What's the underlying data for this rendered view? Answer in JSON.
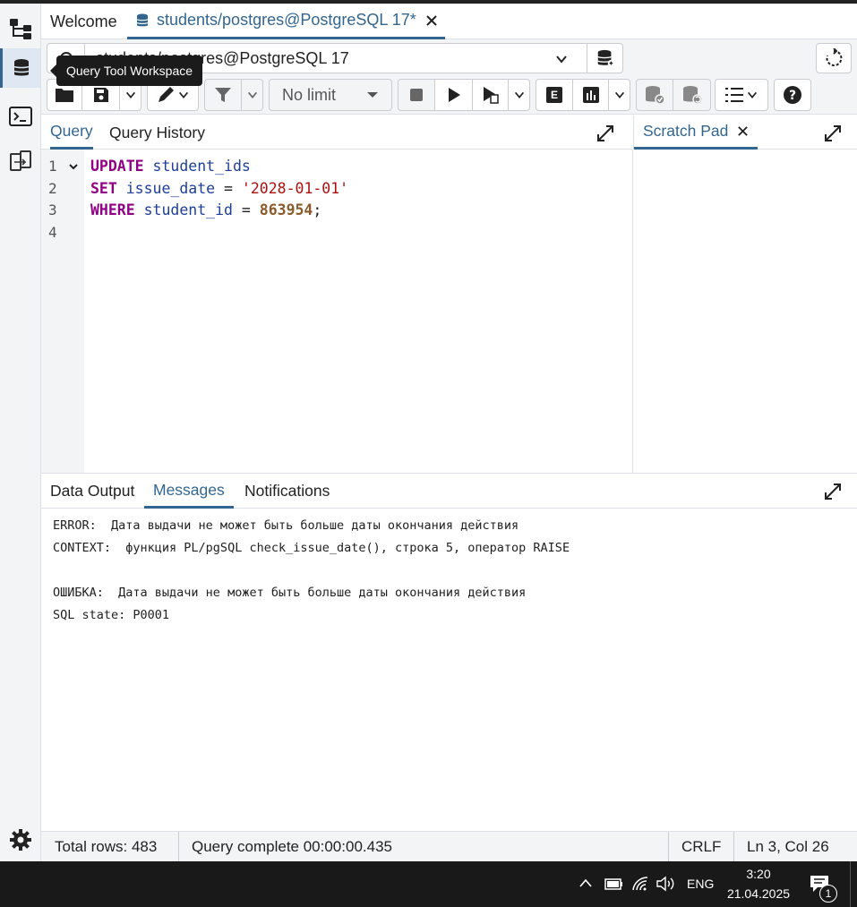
{
  "tabs": {
    "welcome": "Welcome",
    "query_tool": "students/postgres@PostgreSQL 17*"
  },
  "tooltip": "Query Tool Workspace",
  "connection": {
    "value": "students/postgres@PostgreSQL 17"
  },
  "toolbar": {
    "limit": "No limit",
    "explain_label": "E"
  },
  "query_panel": {
    "tabs": [
      "Query",
      "Query History"
    ],
    "active": "Query"
  },
  "scratch": {
    "tab": "Scratch Pad"
  },
  "editor": {
    "line_numbers": [
      "1",
      "2",
      "3",
      "4"
    ],
    "lines": [
      [
        {
          "t": "kw",
          "v": "UPDATE"
        },
        {
          "t": "sp",
          "v": " "
        },
        {
          "t": "id",
          "v": "student_ids"
        }
      ],
      [
        {
          "t": "kw",
          "v": "SET"
        },
        {
          "t": "sp",
          "v": " "
        },
        {
          "t": "id",
          "v": "issue_date"
        },
        {
          "t": "sp",
          "v": " = "
        },
        {
          "t": "str",
          "v": "'2028-01-01'"
        }
      ],
      [
        {
          "t": "kw",
          "v": "WHERE"
        },
        {
          "t": "sp",
          "v": " "
        },
        {
          "t": "id",
          "v": "student_id"
        },
        {
          "t": "sp",
          "v": " = "
        },
        {
          "t": "num",
          "v": "863954"
        },
        {
          "t": "sp",
          "v": ";"
        }
      ],
      []
    ]
  },
  "results": {
    "tabs": [
      "Data Output",
      "Messages",
      "Notifications"
    ],
    "active": "Messages",
    "messages": [
      "ERROR:  Дата выдачи не может быть больше даты окончания действия",
      "CONTEXT:  функция PL/pgSQL check_issue_date(), строка 5, оператор RAISE",
      "",
      "ОШИБКА:  Дата выдачи не может быть больше даты окончания действия",
      "SQL state: P0001"
    ]
  },
  "status": {
    "total_rows": "Total rows: 483",
    "query_complete": "Query complete 00:00:00.435",
    "eol": "CRLF",
    "cursor": "Ln 3, Col 26"
  },
  "taskbar": {
    "lang": "ENG",
    "time": "3:20",
    "date": "21.04.2025",
    "notifications": "1"
  },
  "colors": {
    "accent": "#326690",
    "keyword": "#900085",
    "identifier": "#1d3f9a",
    "string": "#aa1111",
    "number": "#8a5a2a"
  }
}
